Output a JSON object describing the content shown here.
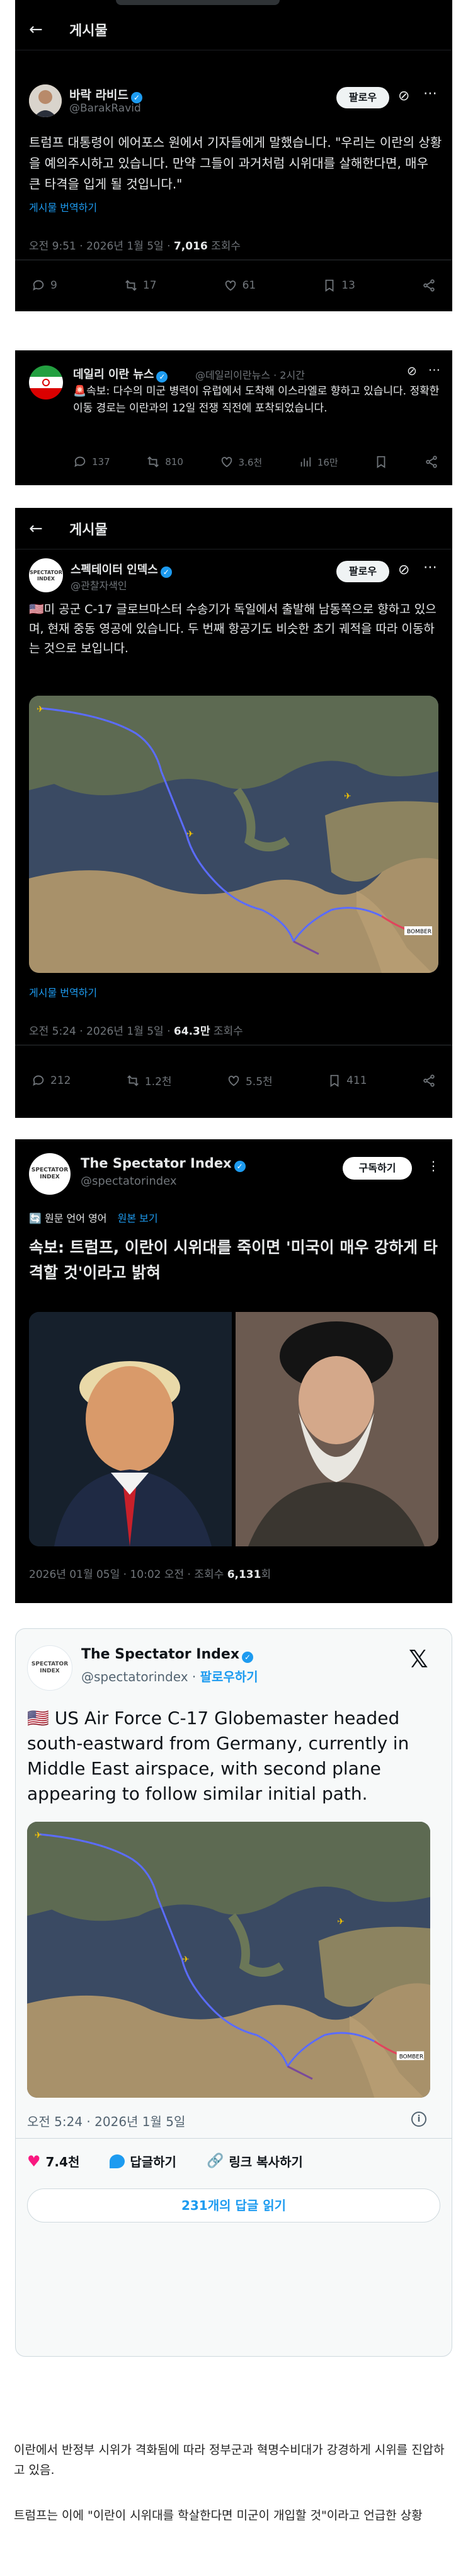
{
  "post1": {
    "header_title": "게시물",
    "author": "바락 라비드",
    "handle": "@BarakRavid",
    "follow_label": "팔로우",
    "text": "트럼프 대통령이 에어포스 원에서 기자들에게 말했습니다. \"우리는 이란의 상황을 예의주시하고 있습니다. 만약 그들이 과거처럼 시위대를 살해한다면, 매우 큰 타격을 입게 될 것입니다.\"",
    "translate_label": "게시물 번역하기",
    "time": "오전 9:51 · 2026년 1월 5일 · ",
    "views": "7,016",
    "views_label": " 조회수",
    "replies": "9",
    "reposts": "17",
    "likes": "61",
    "bookmarks": "13"
  },
  "post2": {
    "author": "데일리 이란 뉴스",
    "handle": "@데일리이란뉴스 · 2시간",
    "text": "🚨속보: 다수의 미군 병력이 유럽에서 도착해 이스라엘로 향하고 있습니다. 정확한 이동 경로는 이란과의 12일 전쟁 직전에 포착되었습니다.",
    "replies": "137",
    "reposts": "810",
    "likes": "3.6천",
    "views": "16만"
  },
  "post3": {
    "header_title": "게시물",
    "author": "스펙테이터 인덱스",
    "handle": "@관찰자색인",
    "avatar_text": "SPECTATOR INDEX",
    "follow_label": "팔로우",
    "text": "🇺🇸미 공군 C-17 글로브마스터 수송기가 독일에서 출발해 남동쪽으로 향하고 있으며, 현재 중동 영공에 있습니다. 두 번째 항공기도 비슷한 초기 궤적을 따라 이동하는 것으로 보입니다.",
    "translate_label": "게시물 번역하기",
    "time": "오전 5:24 · 2026년 1월 5일 · ",
    "views": "64.3만",
    "views_label": " 조회수",
    "replies": "212",
    "reposts": "1.2천",
    "likes": "5.5천",
    "bookmarks": "411"
  },
  "post4": {
    "author": "The Spectator Index",
    "handle": "@spectatorindex",
    "avatar_text": "SPECTATOR INDEX",
    "subscribe_label": "구독하기",
    "orig_lang_label": "원문 언어 영어",
    "orig_view_label": "원본 보기",
    "text": "속보: 트럼프, 이란이 시위대를 죽이면 '미국이 매우 강하게 타격할 것'이라고 밝혀",
    "time": "2026년 01월 05일 · 10:02 오전 · 조회수 ",
    "views": "6,131",
    "views_suffix": "회"
  },
  "post5": {
    "author": "The Spectator Index",
    "handle": "@spectatorindex · ",
    "follow_label": "팔로우하기",
    "avatar_text": "SPECTATOR INDEX",
    "text": "🇺🇸 US Air Force C-17 Globemaster headed south-eastward from Germany, currently in Middle East airspace, with second plane appearing to follow similar initial path.",
    "time": "오전 5:24 · 2026년 1월 5일",
    "likes": "7.4천",
    "reply_label": "답글하기",
    "copy_label": "링크 복사하기",
    "read_replies_label": "231개의 답글 읽기"
  },
  "caption": {
    "line1": "이란에서 반정부 시위가 격화됨에 따라 정부군과 혁명수비대가 강경하게 시위를 진압하고 있음.",
    "line2": "트럼프는 이에 \"이란이 시위대를 학살한다면 미군이 개입할 것\"이라고 언급한 상황"
  },
  "map_label": "BOMBER",
  "colors": {
    "accent": "#1d9bf0",
    "like": "#f91880",
    "map_path": "#5b6cff"
  }
}
